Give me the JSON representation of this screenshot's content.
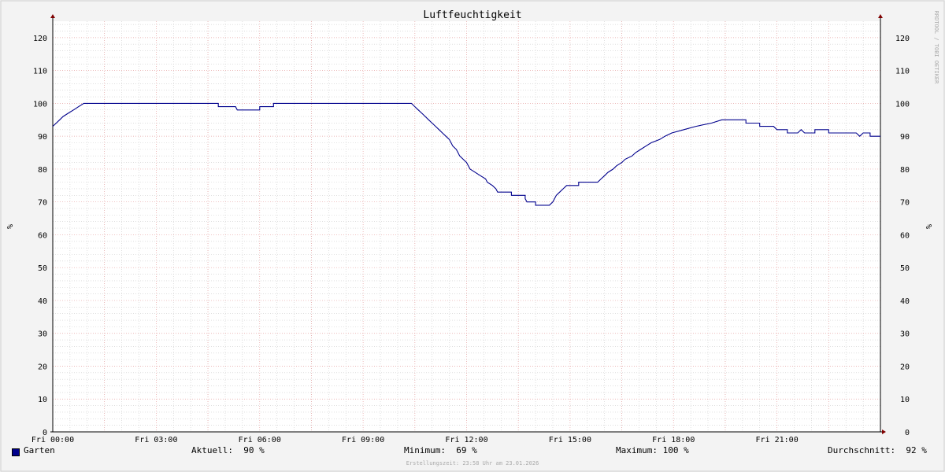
{
  "watermark": "RRDTOOL / TOBI OETIKER",
  "legend": {
    "series_label": "Garten",
    "current": "Aktuell:  90 %",
    "minimum": "Minimum:  69 %",
    "maximum": "Maximum: 100 %",
    "average": "Durchschnitt:  92 %"
  },
  "footer": "Erstellungszeit: 23:58 Uhr am 23.01.2026",
  "colors": {
    "series": "#00008c",
    "major_grid": "#e6a0a0",
    "minor_grid": "#cccccc",
    "arrow": "#800000"
  },
  "chart_data": {
    "type": "line",
    "title": "Luftfeuchtigkeit",
    "ylabel": "%",
    "ylabel_right": "%",
    "ylim": [
      0,
      125
    ],
    "y_ticks": [
      0,
      10,
      20,
      30,
      40,
      50,
      60,
      70,
      80,
      90,
      100,
      110,
      120
    ],
    "xlim_hours": [
      0,
      24
    ],
    "x_ticks": [
      {
        "h": 0,
        "label": "Fri 00:00"
      },
      {
        "h": 3,
        "label": "Fri 03:00"
      },
      {
        "h": 6,
        "label": "Fri 06:00"
      },
      {
        "h": 9,
        "label": "Fri 09:00"
      },
      {
        "h": 12,
        "label": "Fri 12:00"
      },
      {
        "h": 15,
        "label": "Fri 15:00"
      },
      {
        "h": 18,
        "label": "Fri 18:00"
      },
      {
        "h": 21,
        "label": "Fri 21:00"
      }
    ],
    "grid": true,
    "series": [
      {
        "name": "Garten",
        "points": [
          [
            0,
            93
          ],
          [
            0.1,
            94
          ],
          [
            0.2,
            95
          ],
          [
            0.3,
            96
          ],
          [
            0.45,
            97
          ],
          [
            0.6,
            98
          ],
          [
            0.75,
            99
          ],
          [
            0.9,
            100
          ],
          [
            4.8,
            100
          ],
          [
            4.8,
            99
          ],
          [
            5.3,
            99
          ],
          [
            5.35,
            98
          ],
          [
            5.5,
            98
          ],
          [
            6.0,
            98
          ],
          [
            6.0,
            99
          ],
          [
            6.4,
            99
          ],
          [
            6.4,
            100
          ],
          [
            10.4,
            100
          ],
          [
            10.5,
            99
          ],
          [
            10.6,
            98
          ],
          [
            10.7,
            97
          ],
          [
            10.8,
            96
          ],
          [
            10.9,
            95
          ],
          [
            11.0,
            94
          ],
          [
            11.1,
            93
          ],
          [
            11.2,
            92
          ],
          [
            11.3,
            91
          ],
          [
            11.4,
            90
          ],
          [
            11.5,
            89
          ],
          [
            11.55,
            88
          ],
          [
            11.6,
            87
          ],
          [
            11.7,
            86
          ],
          [
            11.75,
            85
          ],
          [
            11.8,
            84
          ],
          [
            11.9,
            83
          ],
          [
            12.0,
            82
          ],
          [
            12.05,
            81
          ],
          [
            12.1,
            80
          ],
          [
            12.25,
            79
          ],
          [
            12.4,
            78
          ],
          [
            12.55,
            77
          ],
          [
            12.6,
            76
          ],
          [
            12.75,
            75
          ],
          [
            12.85,
            74
          ],
          [
            12.9,
            73
          ],
          [
            13.3,
            73
          ],
          [
            13.3,
            72
          ],
          [
            13.7,
            72
          ],
          [
            13.7,
            71
          ],
          [
            13.75,
            70
          ],
          [
            14.0,
            70
          ],
          [
            14.0,
            69
          ],
          [
            14.4,
            69
          ],
          [
            14.5,
            70
          ],
          [
            14.55,
            71
          ],
          [
            14.6,
            72
          ],
          [
            14.7,
            73
          ],
          [
            14.8,
            74
          ],
          [
            14.9,
            75
          ],
          [
            15.25,
            75
          ],
          [
            15.25,
            76
          ],
          [
            15.8,
            76
          ],
          [
            15.9,
            77
          ],
          [
            16.0,
            78
          ],
          [
            16.1,
            79
          ],
          [
            16.25,
            80
          ],
          [
            16.35,
            81
          ],
          [
            16.5,
            82
          ],
          [
            16.6,
            83
          ],
          [
            16.8,
            84
          ],
          [
            16.9,
            85
          ],
          [
            17.05,
            86
          ],
          [
            17.2,
            87
          ],
          [
            17.35,
            88
          ],
          [
            17.6,
            89
          ],
          [
            17.75,
            90
          ],
          [
            17.95,
            91
          ],
          [
            18.3,
            92
          ],
          [
            18.65,
            93
          ],
          [
            19.1,
            94
          ],
          [
            19.4,
            95
          ],
          [
            20.1,
            95
          ],
          [
            20.1,
            94
          ],
          [
            20.5,
            94
          ],
          [
            20.5,
            93
          ],
          [
            20.9,
            93
          ],
          [
            21.0,
            92
          ],
          [
            21.3,
            92
          ],
          [
            21.3,
            91
          ],
          [
            21.6,
            91
          ],
          [
            21.7,
            92
          ],
          [
            21.8,
            91
          ],
          [
            22.1,
            91
          ],
          [
            22.1,
            92
          ],
          [
            22.5,
            92
          ],
          [
            22.5,
            91
          ],
          [
            23.3,
            91
          ],
          [
            23.4,
            90
          ],
          [
            23.5,
            91
          ],
          [
            23.7,
            91
          ],
          [
            23.7,
            90
          ],
          [
            24.0,
            90
          ]
        ]
      }
    ]
  }
}
